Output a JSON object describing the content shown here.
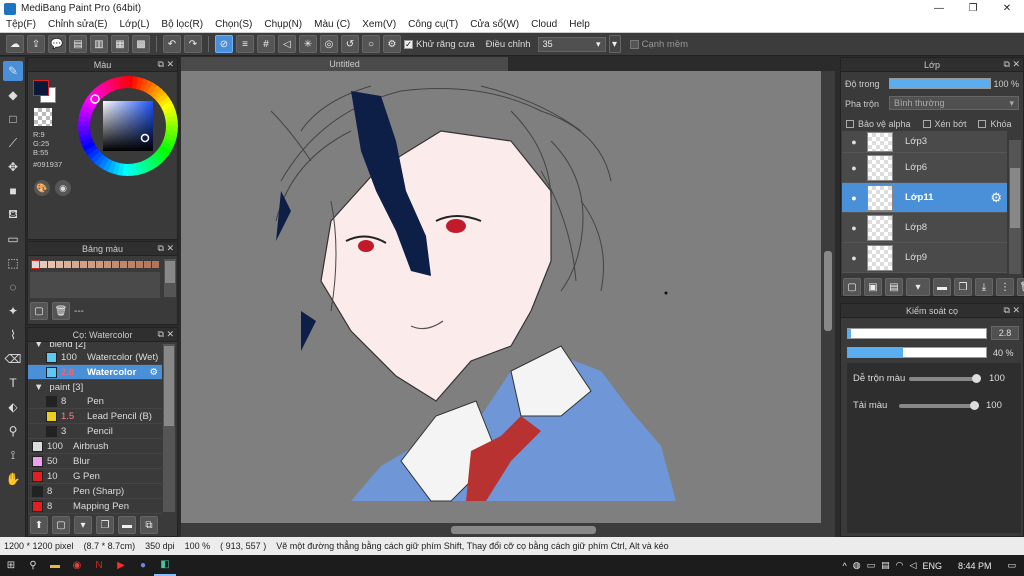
{
  "window": {
    "title": "MediBang Paint Pro (64bit)"
  },
  "menu": [
    "Tệp(F)",
    "Chỉnh sửa(E)",
    "Lớp(L)",
    "Bộ lọc(R)",
    "Chọn(S)",
    "Chụp(N)",
    "Màu (C)",
    "Xem(V)",
    "Công cụ(T)",
    "Cửa sổ(W)",
    "Cloud",
    "Help"
  ],
  "toolbar": {
    "antialias_label": "Khử răng cưa",
    "adjust_label": "Điều chỉnh",
    "adjust_value": "35",
    "edge_label": "Cạnh mềm"
  },
  "color_panel": {
    "title": "Màu",
    "r": "R:9",
    "g": "G:25",
    "b": "B:55",
    "hex": "#091937",
    "primary_color": "#091937",
    "secondary_color": "#ffffff"
  },
  "palette_panel": {
    "title": "Bảng màu",
    "swatches": [
      "#d9d9d9",
      "#e8c8b8",
      "#e6c2ad",
      "#e0b8a0",
      "#dab09a",
      "#d6a890",
      "#d2a088",
      "#cf9c82",
      "#cc987e",
      "#c8927a",
      "#c48c74",
      "#c0876e",
      "#bd8268",
      "#b97d62",
      "#b6785d",
      "#b27358"
    ],
    "footer_text": "---"
  },
  "brush_panel": {
    "title": "Cọ: Watercolor",
    "groups": [
      {
        "name": "blend [2]",
        "items": [
          {
            "size": "100",
            "name": "Watercolor (Wet)",
            "color": "#5fc8f0",
            "selected": false
          },
          {
            "size": "2.8",
            "name": "Watercolor",
            "color": "#5fc8f0",
            "selected": true
          }
        ]
      },
      {
        "name": "paint [3]",
        "items": [
          {
            "size": "8",
            "name": "Pen",
            "color": "#222222",
            "selected": false
          },
          {
            "size": "1.5",
            "name": "Lead Pencil (B)",
            "color": "#e8d020",
            "selected": false
          },
          {
            "size": "3",
            "name": "Pencil",
            "color": "#222222",
            "selected": false
          }
        ]
      }
    ],
    "ungrouped": [
      {
        "size": "100",
        "name": "Airbrush",
        "color": "#dddddd"
      },
      {
        "size": "50",
        "name": "Blur",
        "color": "#f0a0f0"
      },
      {
        "size": "10",
        "name": "G Pen",
        "color": "#e02020"
      },
      {
        "size": "8",
        "name": "Pen (Sharp)",
        "color": "#222222"
      },
      {
        "size": "8",
        "name": "Mapping Pen",
        "color": "#e02020"
      }
    ]
  },
  "canvas": {
    "tab_title": "Untitled"
  },
  "layer_panel": {
    "title": "Lớp",
    "opacity_label": "Độ trong",
    "opacity_value": "100 %",
    "opacity_fraction": 1.0,
    "blend_label": "Pha trộn",
    "blend_value": "Bình thường",
    "protect_alpha": "Bảo vệ alpha",
    "clipping": "Xén bớt",
    "lock": "Khóa",
    "layers": [
      {
        "name": "Lớp3",
        "selected": false
      },
      {
        "name": "Lớp6",
        "selected": false
      },
      {
        "name": "Lớp11",
        "selected": true
      },
      {
        "name": "Lớp8",
        "selected": false
      },
      {
        "name": "Lớp9",
        "selected": false
      }
    ]
  },
  "brush_control": {
    "title": "Kiểm soát cọ",
    "size_value": "2.8",
    "size_fraction": 0.02,
    "opacity_value": "40 %",
    "opacity_fraction": 0.4,
    "blend_label": "Dễ trộn màu",
    "blend_value": "100",
    "load_label": "Tải màu",
    "load_value": "100"
  },
  "status": {
    "dimensions": "1200 * 1200 pixel",
    "physical": "(8.7 * 8.7cm)",
    "dpi": "350 dpi",
    "zoom": "100 %",
    "coords": "( 913, 557 )",
    "hint": "Vẽ một đường thẳng bằng cách giữ phím Shift, Thay đổi cỡ cọ bằng cách giữ phím Ctrl, Alt và kéo"
  },
  "taskbar": {
    "lang": "ENG",
    "time": "8:44 PM"
  }
}
